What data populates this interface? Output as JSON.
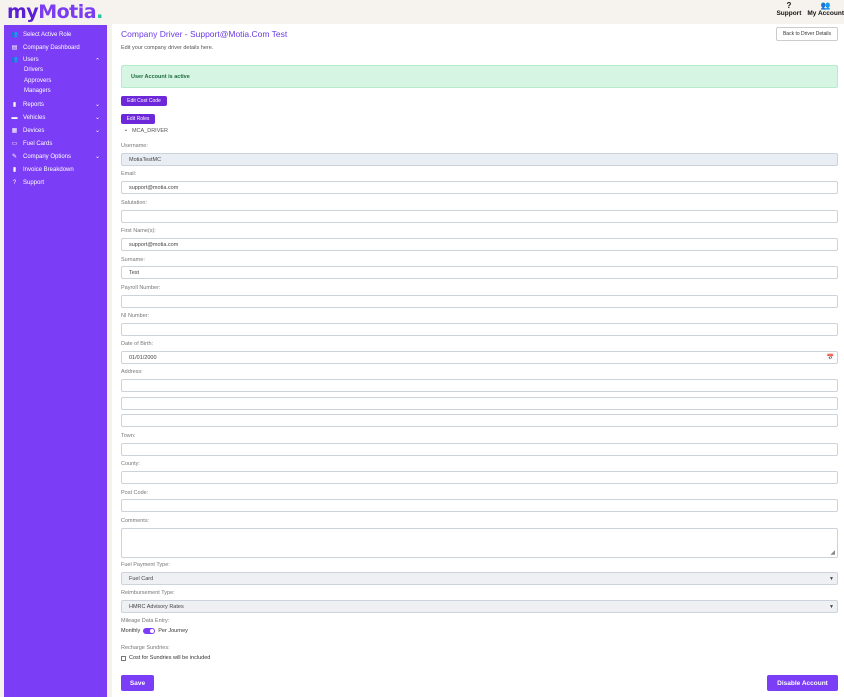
{
  "header": {
    "logo_my": "my",
    "logo_motia": "Motia",
    "logo_dot": ".",
    "support_label": "Support",
    "support_icon": "?",
    "account_label": "My Account",
    "account_icon": "👥"
  },
  "sidebar": {
    "items": [
      {
        "label": "Select Active Role",
        "icon": "users-icon",
        "glyph": "👥"
      },
      {
        "label": "Company Dashboard",
        "icon": "dashboard-icon",
        "glyph": "▤"
      },
      {
        "label": "Users",
        "icon": "users-icon",
        "glyph": "👥",
        "expanded": true
      },
      {
        "label": "Reports",
        "icon": "report-icon",
        "glyph": "▮"
      },
      {
        "label": "Vehicles",
        "icon": "truck-icon",
        "glyph": "▬"
      },
      {
        "label": "Devices",
        "icon": "cart-icon",
        "glyph": "▦"
      },
      {
        "label": "Fuel Cards",
        "icon": "card-icon",
        "glyph": "▭"
      },
      {
        "label": "Company Options",
        "icon": "wrench-icon",
        "glyph": "✎"
      },
      {
        "label": "Invoice Breakdown",
        "icon": "invoice-icon",
        "glyph": "▮"
      },
      {
        "label": "Support",
        "icon": "question-icon",
        "glyph": "?"
      }
    ],
    "users_sub": [
      "Drivers",
      "Approvers",
      "Managers"
    ],
    "chevron": "⌄"
  },
  "main": {
    "title": "Company Driver - Support@Motia.Com Test",
    "subtitle": "Edit your company driver details here.",
    "back_button": "Back to Driver Details",
    "alert": "User Account is active",
    "edit_cost_code": "Edit Cost Code",
    "edit_roles": "Edit Roles",
    "roles": [
      "MCA_DRIVER"
    ],
    "bullet": "•"
  },
  "form": {
    "username": {
      "label": "Username:",
      "value": "MotiaTestMC"
    },
    "email": {
      "label": "Email:",
      "value": "support@motia.com"
    },
    "salutation": {
      "label": "Salutation:",
      "value": ""
    },
    "first_names": {
      "label": "First Name(s):",
      "value": "support@motia.com"
    },
    "surname": {
      "label": "Surname:",
      "value": "Test"
    },
    "payroll": {
      "label": "Payroll Number:",
      "value": ""
    },
    "ni_number": {
      "label": "NI Number:",
      "value": ""
    },
    "dob": {
      "label": "Date of Birth:",
      "value": "01/01/2000"
    },
    "address": {
      "label": "Address:",
      "lines": [
        "",
        "",
        ""
      ]
    },
    "town": {
      "label": "Town:",
      "value": ""
    },
    "county": {
      "label": "County:",
      "value": ""
    },
    "postcode": {
      "label": "Post Code:",
      "value": ""
    },
    "comments": {
      "label": "Comments:",
      "value": ""
    },
    "fuel_payment": {
      "label": "Fuel Payment Type:",
      "value": "Fuel Card"
    },
    "reimbursement": {
      "label": "Reimbursement Type:",
      "value": "HMRC Advisory Rates"
    },
    "mileage": {
      "label": "Mileage Data Entry:",
      "left": "Monthly",
      "right": "Per Journey",
      "per_journey_selected": true
    },
    "recharge": {
      "label": "Recharge Sundries:",
      "checkbox_label": "Cost for Sundries will be included",
      "checked": false
    },
    "save": "Save",
    "disable": "Disable Account",
    "select_arrow": "▼",
    "calendar_glyph": "📅",
    "resize_glyph": "◢"
  },
  "colors": {
    "brand": "#7b3df6",
    "alert_bg": "#d6f5e3",
    "alert_text": "#1c6b3f"
  }
}
